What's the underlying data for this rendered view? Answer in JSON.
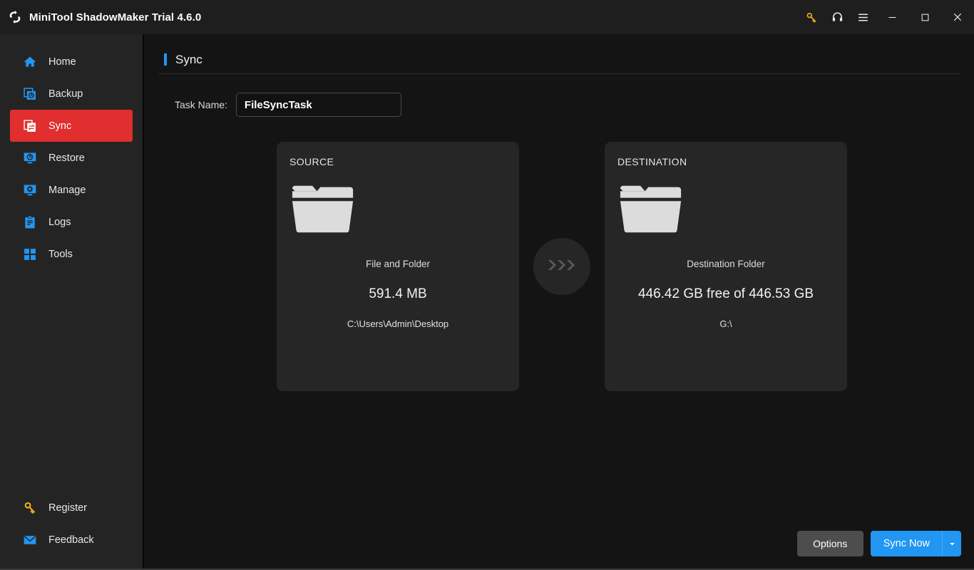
{
  "titlebar": {
    "app_title": "MiniTool ShadowMaker Trial 4.6.0",
    "logo_icon": "sync-logo-icon",
    "buttons": [
      {
        "name": "key-icon",
        "label": ""
      },
      {
        "name": "headset-icon",
        "label": ""
      },
      {
        "name": "hamburger-menu-icon",
        "label": ""
      },
      {
        "name": "minimize-icon",
        "label": ""
      },
      {
        "name": "maximize-icon",
        "label": ""
      },
      {
        "name": "close-icon",
        "label": ""
      }
    ],
    "colors": {
      "key": "#f2b01e",
      "bg": "#1e1e1e"
    }
  },
  "sidebar": {
    "items": [
      {
        "label": "Home",
        "icon": "home-icon",
        "active": false
      },
      {
        "label": "Backup",
        "icon": "backup-icon",
        "active": false
      },
      {
        "label": "Sync",
        "icon": "sync-icon",
        "active": true
      },
      {
        "label": "Restore",
        "icon": "restore-icon",
        "active": false
      },
      {
        "label": "Manage",
        "icon": "manage-icon",
        "active": false
      },
      {
        "label": "Logs",
        "icon": "logs-icon",
        "active": false
      },
      {
        "label": "Tools",
        "icon": "tools-icon",
        "active": false
      }
    ],
    "bottom_items": [
      {
        "label": "Register",
        "icon": "key-icon"
      },
      {
        "label": "Feedback",
        "icon": "envelope-icon"
      }
    ],
    "colors": {
      "active_bg": "#e12e2e",
      "icon_blue": "#2196f3",
      "icon_gold": "#f2b01e",
      "bg": "#242424"
    }
  },
  "main": {
    "page_title": "Sync",
    "accent_color": "#2196f3",
    "task": {
      "label": "Task Name:",
      "value": "FileSyncTask",
      "placeholder": "Task Name"
    },
    "source_panel": {
      "title": "SOURCE",
      "icon": "folder-icon",
      "subtitle": "File and Folder",
      "main_value": "591.4 MB",
      "path": "C:\\Users\\Admin\\Desktop"
    },
    "destination_panel": {
      "title": "DESTINATION",
      "icon": "folder-icon",
      "subtitle": "Destination Folder",
      "main_value": "446.42 GB free of 446.53 GB",
      "path": "G:\\"
    },
    "transfer_arrow": {
      "icon": "triple-chevron-right-icon"
    }
  },
  "footer": {
    "options_label": "Options",
    "sync_now_label": "Sync Now",
    "dropdown_icon": "caret-down-icon",
    "colors": {
      "primary": "#2196f3",
      "secondary": "#4d4d4d"
    }
  }
}
